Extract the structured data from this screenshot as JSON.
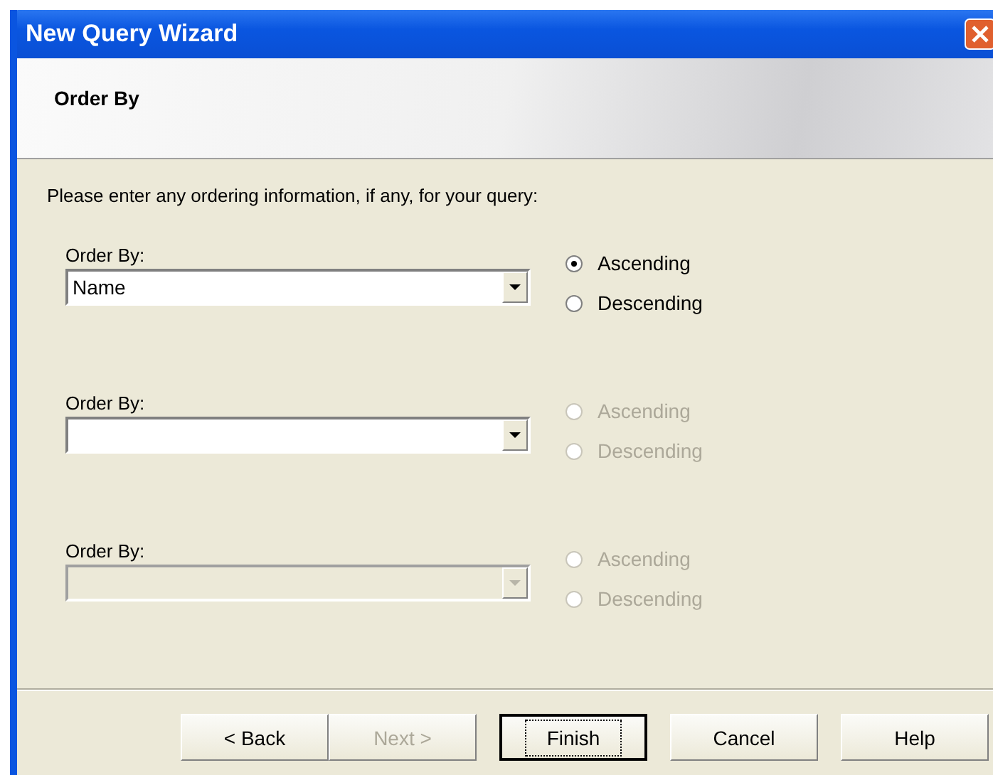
{
  "window": {
    "title": "New Query Wizard"
  },
  "header": {
    "title": "Order By"
  },
  "instructions": "Please enter any ordering information, if any, for your query:",
  "sort_rows": [
    {
      "label": "Order By:",
      "value": "Name",
      "disabled": false,
      "options": [
        {
          "label": "Ascending",
          "selected": true,
          "disabled": false
        },
        {
          "label": "Descending",
          "selected": false,
          "disabled": false
        }
      ]
    },
    {
      "label": "Order By:",
      "disabled": false,
      "options": [
        {
          "label": "Ascending",
          "selected": false,
          "disabled": true
        },
        {
          "label": "Descending",
          "selected": false,
          "disabled": true
        }
      ]
    },
    {
      "label": "Order By:",
      "disabled": true,
      "options": [
        {
          "label": "Ascending",
          "selected": false,
          "disabled": true
        },
        {
          "label": "Descending",
          "selected": false,
          "disabled": true
        }
      ]
    }
  ],
  "buttons": [
    {
      "label": "< Back",
      "disabled": false,
      "default": false
    },
    {
      "label": "Next >",
      "disabled": true,
      "default": false
    },
    {
      "label": "Finish",
      "disabled": false,
      "default": true
    },
    {
      "label": "Cancel",
      "disabled": false,
      "default": false
    },
    {
      "label": "Help",
      "disabled": false,
      "default": false
    }
  ]
}
